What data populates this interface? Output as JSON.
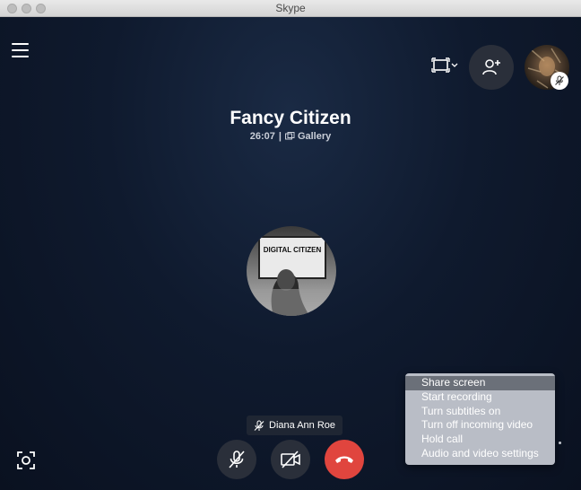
{
  "window": {
    "title": "Skype",
    "traffic_lights": [
      "close",
      "minimize",
      "zoom"
    ]
  },
  "call": {
    "name": "Fancy Citizen",
    "duration": "26:07",
    "separator": "|",
    "view_mode": "Gallery"
  },
  "participant": {
    "name": "Diana Ann Roe",
    "avatar_caption": "DIGITAL CITIZEN",
    "muted": true
  },
  "self_view": {
    "muted": true
  },
  "colors": {
    "background": "#0b1322",
    "control_button": "#2a2f3a",
    "hangup": "#e0453e",
    "menu_background": "#b9bdc6",
    "menu_highlight": "#6b7079"
  },
  "icons": {
    "menu": "hamburger-icon",
    "layout": "layout-switch-icon",
    "add_people": "add-person-icon",
    "snapshot": "snapshot-icon",
    "mic_off": "mic-off-icon",
    "video_off": "video-off-icon",
    "hang_up": "phone-hangup-icon"
  },
  "more_menu": {
    "items": [
      {
        "label": "Share screen",
        "selected": true
      },
      {
        "label": "Start recording",
        "selected": false
      },
      {
        "label": "Turn subtitles on",
        "selected": false
      },
      {
        "label": "Turn off incoming video",
        "selected": false
      },
      {
        "label": "Hold call",
        "selected": false
      },
      {
        "label": "Audio and video settings",
        "selected": false
      }
    ]
  }
}
